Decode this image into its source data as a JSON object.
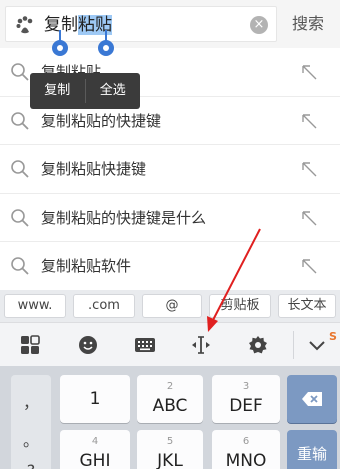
{
  "search": {
    "query_plain": "复制",
    "query_selected": "粘贴",
    "clear_icon": "×",
    "submit_label": "搜索"
  },
  "context_menu": {
    "copy": "复制",
    "select_all": "全选"
  },
  "suggestions": [
    {
      "text": "复制粘贴"
    },
    {
      "text": "复制粘贴的快捷键"
    },
    {
      "text": "复制粘贴快捷键"
    },
    {
      "text": "复制粘贴的快捷键是什么"
    },
    {
      "text": "复制粘贴软件"
    }
  ],
  "shortcuts": [
    {
      "label": "www."
    },
    {
      "label": ".com"
    },
    {
      "label": "@"
    },
    {
      "label": "剪贴板"
    },
    {
      "label": "长文本"
    }
  ],
  "toolbar": {
    "icons": [
      "grid-icon",
      "emoji-icon",
      "keyboard-icon",
      "cursor-icon",
      "settings-icon",
      "collapse-icon"
    ],
    "mark": "S"
  },
  "keyboard": {
    "symbols": [
      "，",
      "。",
      "?"
    ],
    "keys": [
      {
        "num": "",
        "letters": "1"
      },
      {
        "num": "2",
        "letters": "ABC"
      },
      {
        "num": "3",
        "letters": "DEF"
      },
      {
        "num": "4",
        "letters": "GHI"
      },
      {
        "num": "5",
        "letters": "JKL"
      },
      {
        "num": "6",
        "letters": "MNO"
      }
    ],
    "backspace_icon": "⌫",
    "reenter_label": "重输"
  },
  "colors": {
    "selection": "#9ec9f5",
    "handle": "#3a78d4",
    "annotation_arrow": "#e02020",
    "dark_key": "#7c99c2"
  }
}
